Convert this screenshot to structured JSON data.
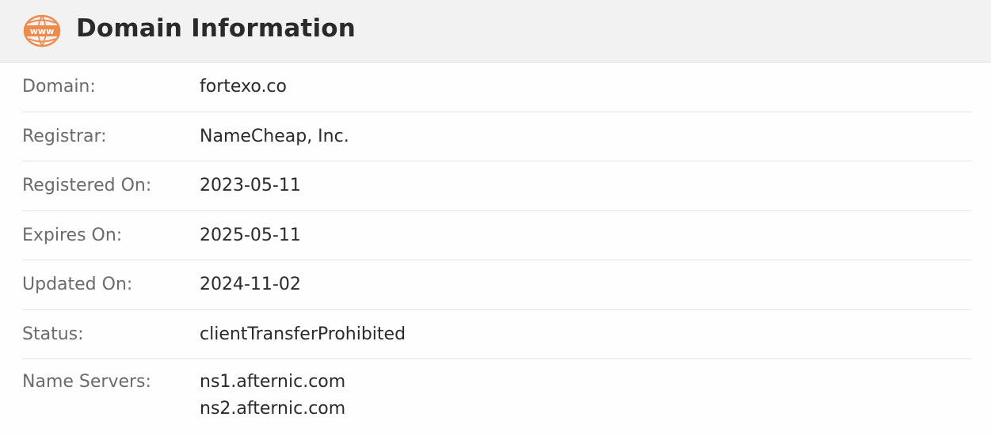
{
  "header": {
    "title": "Domain Information",
    "icon": "www-globe-icon",
    "icon_text": "www",
    "icon_color": "#f08a4b"
  },
  "rows": [
    {
      "label": "Domain:",
      "value": "fortexo.co"
    },
    {
      "label": "Registrar:",
      "value": "NameCheap, Inc."
    },
    {
      "label": "Registered On:",
      "value": "2023-05-11"
    },
    {
      "label": "Expires On:",
      "value": "2025-05-11"
    },
    {
      "label": "Updated On:",
      "value": "2024-11-02"
    },
    {
      "label": "Status:",
      "value": "clientTransferProhibited"
    }
  ],
  "name_servers": {
    "label": "Name Servers:",
    "values": [
      "ns1.afternic.com",
      "ns2.afternic.com"
    ]
  }
}
